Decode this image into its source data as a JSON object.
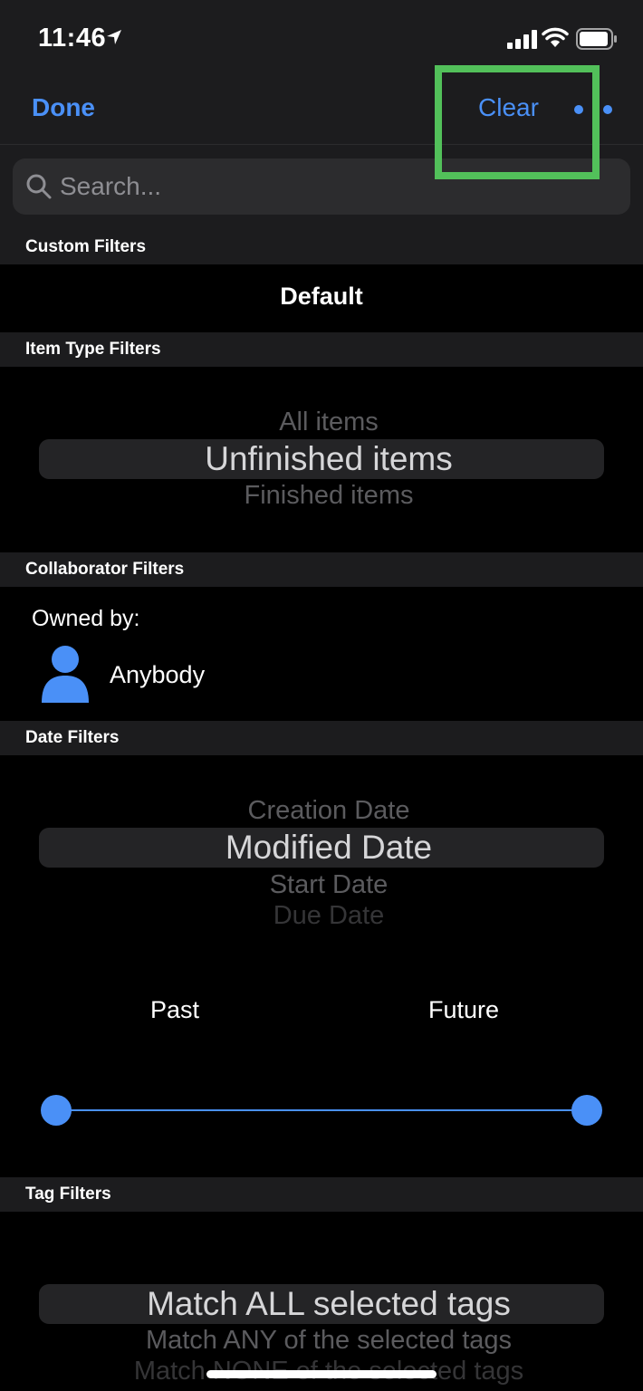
{
  "status_bar": {
    "time": "11:46"
  },
  "nav": {
    "done_label": "Done",
    "clear_label": "Clear"
  },
  "search": {
    "placeholder": "Search..."
  },
  "sections": {
    "custom_filters": "Custom Filters",
    "item_type_filters": "Item Type Filters",
    "collaborator_filters": "Collaborator Filters",
    "date_filters": "Date Filters",
    "tag_filters": "Tag Filters"
  },
  "custom_filters": {
    "selected": "Default"
  },
  "item_type_picker": {
    "options": [
      "All items",
      "Unfinished items",
      "Finished items"
    ],
    "selected": "Unfinished items"
  },
  "collaborator": {
    "owned_by_label": "Owned by:",
    "owner": "Anybody"
  },
  "date_picker": {
    "options": [
      "Creation Date",
      "Modified Date",
      "Start Date",
      "Due Date"
    ],
    "selected": "Modified Date"
  },
  "date_range": {
    "start_label": "Past",
    "end_label": "Future",
    "start_value": 0,
    "end_value": 1
  },
  "tag_picker": {
    "options": [
      "Match ALL selected tags",
      "Match ANY of the selected tags",
      "Match NONE of the selected tags"
    ],
    "selected": "Match ALL selected tags"
  },
  "colors": {
    "accent": "#4a90f7",
    "highlight_outline": "#52c05a",
    "background": "#000000",
    "bar": "#1c1c1e"
  }
}
